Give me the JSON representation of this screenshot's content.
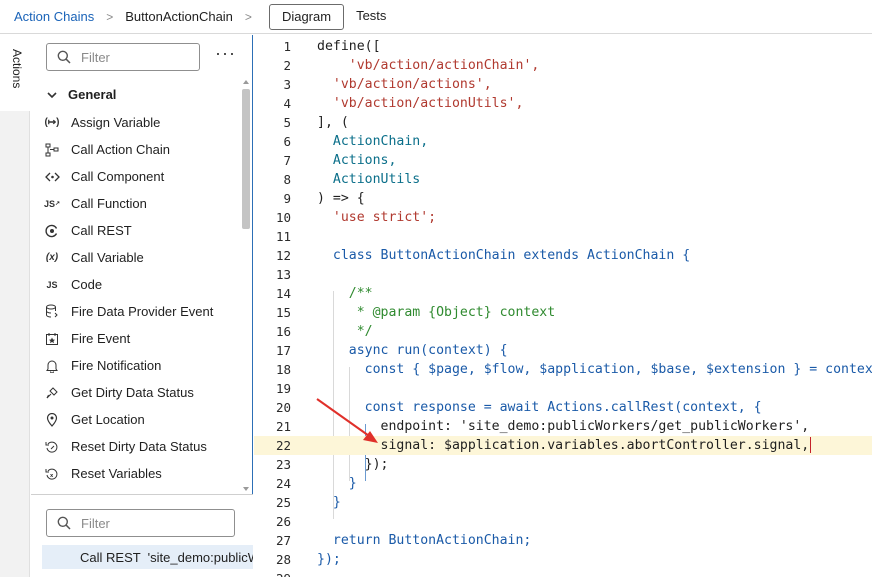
{
  "breadcrumb": {
    "items": [
      "Action Chains",
      "ButtonActionChain"
    ],
    "separator": ">"
  },
  "tabs": [
    {
      "label": "Diagram",
      "active": true
    },
    {
      "label": "Tests",
      "active": false
    }
  ],
  "rail": {
    "tab_label": "Actions"
  },
  "palette": {
    "filter_placeholder": "Filter",
    "more_label": "···",
    "group": "General",
    "items": [
      {
        "label": "Assign Variable",
        "icon": "assign-variable-icon"
      },
      {
        "label": "Call Action Chain",
        "icon": "call-action-chain-icon"
      },
      {
        "label": "Call Component",
        "icon": "call-component-icon"
      },
      {
        "label": "Call Function",
        "icon": "call-function-icon"
      },
      {
        "label": "Call REST",
        "icon": "call-rest-icon"
      },
      {
        "label": "Call Variable",
        "icon": "call-variable-icon"
      },
      {
        "label": "Code",
        "icon": "code-icon"
      },
      {
        "label": "Fire Data Provider Event",
        "icon": "fire-data-provider-event-icon"
      },
      {
        "label": "Fire Event",
        "icon": "fire-event-icon"
      },
      {
        "label": "Fire Notification",
        "icon": "fire-notification-icon"
      },
      {
        "label": "Get Dirty Data Status",
        "icon": "get-dirty-data-status-icon"
      },
      {
        "label": "Get Location",
        "icon": "get-location-icon"
      },
      {
        "label": "Reset Dirty Data Status",
        "icon": "reset-dirty-data-status-icon"
      },
      {
        "label": "Reset Variables",
        "icon": "reset-variables-icon"
      }
    ]
  },
  "structure": {
    "filter_placeholder": "Filter",
    "selected_row": "Call REST  'site_demo:publicW"
  },
  "editor": {
    "highlighted_line": 22,
    "lines": [
      "define([",
      "  'vb/action/actionChain',",
      "  'vb/action/actions',",
      "  'vb/action/actionUtils',",
      "], (",
      "  ActionChain,",
      "  Actions,",
      "  ActionUtils",
      ") => {",
      "  'use strict';",
      "",
      "  class ButtonActionChain extends ActionChain {",
      "",
      "    /**",
      "     * @param {Object} context",
      "     */",
      "    async run(context) {",
      "      const { $page, $flow, $application, $base, $extension } = context;",
      "",
      "      const response = await Actions.callRest(context, {",
      "        endpoint: 'site_demo:publicWorkers/get_publicWorkers',",
      "        signal: $application.variables.abortController.signal,",
      "      });",
      "    }",
      "  }",
      "",
      "  return ButtonActionChain;",
      "});",
      ""
    ]
  },
  "colors": {
    "accent": "#1a63b8",
    "highlight_line": "#fdf6d8",
    "arrow": "#e0302a"
  }
}
